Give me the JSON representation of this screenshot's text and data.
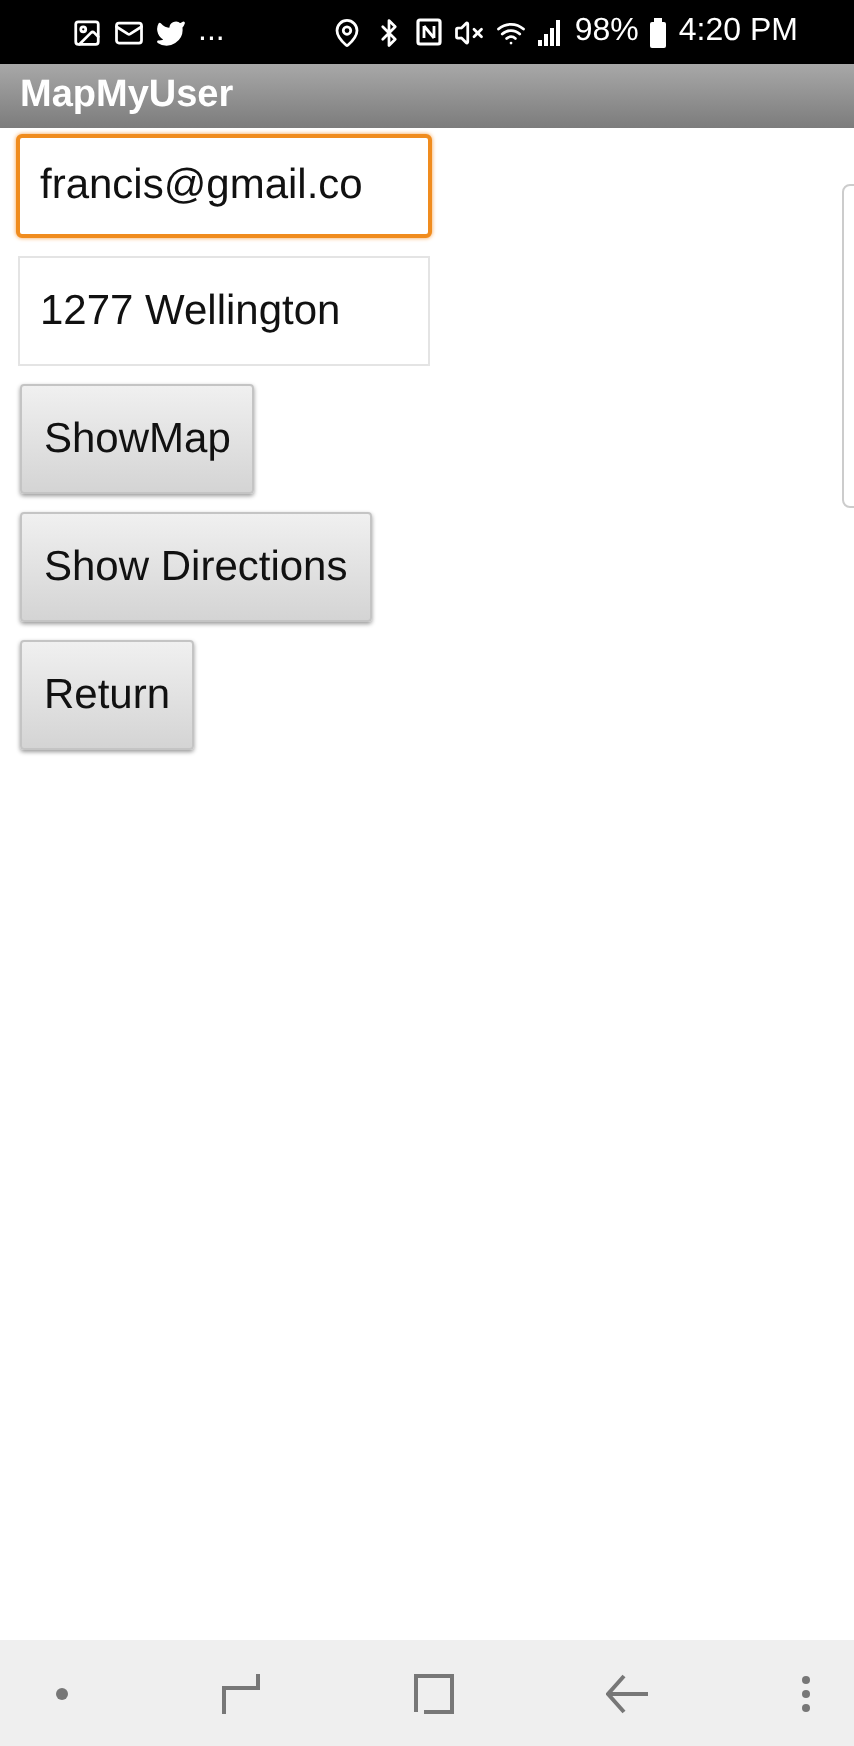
{
  "status_bar": {
    "overflow": "...",
    "battery": "98%",
    "time": "4:20 PM"
  },
  "title_bar": {
    "title": "MapMyUser"
  },
  "fields": [
    {
      "value": "francis@gmail.co",
      "focused": true
    },
    {
      "value": "1277 Wellington",
      "focused": false
    }
  ],
  "buttons": [
    "ShowMap",
    "Show Directions",
    "Return"
  ]
}
